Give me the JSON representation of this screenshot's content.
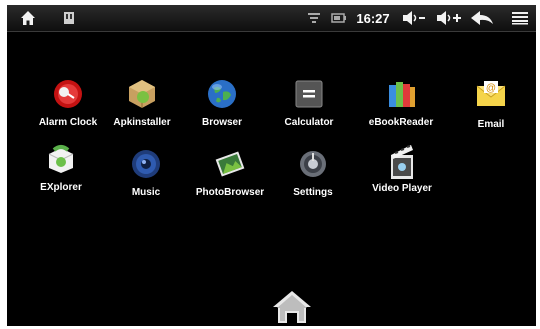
{
  "status_bar": {
    "left_icons": [
      "home-icon",
      "storage-icon"
    ],
    "right_icons": [
      "wifi-icon",
      "battery-icon",
      "volume-down-icon",
      "volume-up-icon",
      "back-icon",
      "menu-icon"
    ],
    "time": "16:27"
  },
  "apps": [
    {
      "label": "Alarm Clock",
      "icon": "alarm-clock-icon"
    },
    {
      "label": "Apkinstaller",
      "icon": "package-icon"
    },
    {
      "label": "Browser",
      "icon": "globe-icon"
    },
    {
      "label": "Calculator",
      "icon": "calculator-icon"
    },
    {
      "label": "eBookReader",
      "icon": "books-icon"
    },
    {
      "label": "Email",
      "icon": "envelope-icon"
    },
    {
      "label": "EXplorer",
      "icon": "file-explorer-icon"
    },
    {
      "label": "Music",
      "icon": "speaker-icon"
    },
    {
      "label": "PhotoBrowser",
      "icon": "photo-icon"
    },
    {
      "label": "Settings",
      "icon": "settings-icon"
    },
    {
      "label": "Video Player",
      "icon": "clapperboard-icon"
    }
  ],
  "dock": {
    "icon": "home-icon"
  },
  "colors": {
    "background": "#000000",
    "statusbar": "#1c1c1c",
    "text": "#ffffff"
  }
}
